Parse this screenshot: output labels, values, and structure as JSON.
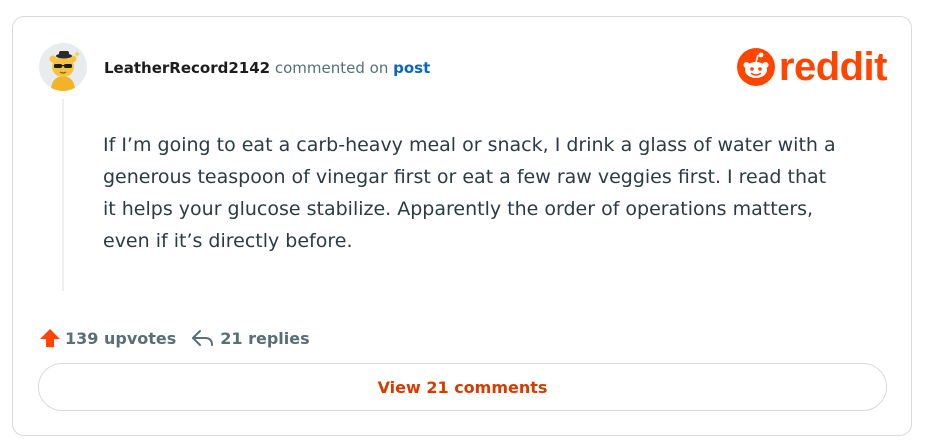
{
  "comment": {
    "username": "LeatherRecord2142",
    "action_text": "commented on",
    "post_link": "post",
    "body": "If I’m going to eat a carb-heavy meal or snack, I drink a glass of water with a generous teaspoon of vinegar first or eat a few raw veggies first. I read that it helps your glucose stabilize. Apparently the order of operations matters, even if it’s directly before."
  },
  "brand": {
    "logo_text": "reddit",
    "logo_icon": "reddit-snoo-icon",
    "color": "#ff4500"
  },
  "stats": {
    "upvotes": "139 upvotes",
    "upvote_icon": "upvote-arrow-icon",
    "replies": "21 replies",
    "reply_icon": "reply-arrow-icon"
  },
  "footer": {
    "view_comments_label": "View 21 comments"
  },
  "colors": {
    "accent": "#ff4500",
    "link": "#0a66c2",
    "button_text": "#d93a00",
    "muted": "#576f76"
  }
}
